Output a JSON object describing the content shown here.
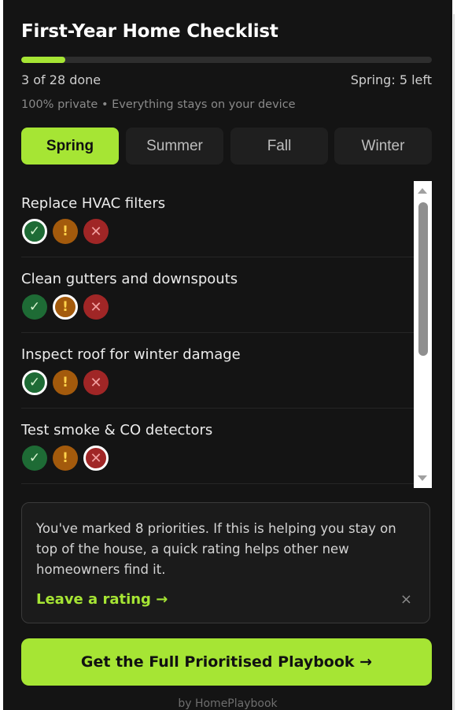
{
  "header": {
    "title": "First-Year Home Checklist",
    "progress_fraction": 0.107,
    "done_text": "3 of 28 done",
    "season_left_text": "Spring: 5 left",
    "privacy_note": "100% private • Everything stays on your device"
  },
  "tabs": [
    {
      "label": "Spring",
      "active": true
    },
    {
      "label": "Summer",
      "active": false
    },
    {
      "label": "Fall",
      "active": false
    },
    {
      "label": "Winter",
      "active": false
    }
  ],
  "status_glyphs": {
    "ok": "✓",
    "warn": "!",
    "no": "✕"
  },
  "tasks": [
    {
      "title": "Replace HVAC filters",
      "selected": "ok"
    },
    {
      "title": "Clean gutters and downspouts",
      "selected": "warn"
    },
    {
      "title": "Inspect roof for winter damage",
      "selected": "ok"
    },
    {
      "title": "Test smoke & CO detectors",
      "selected": "no"
    }
  ],
  "rating_card": {
    "message": "You've marked 8 priorities. If this is helping you stay on top of the house, a quick rating helps other new homeowners find it.",
    "link_label": "Leave a rating →",
    "close_glyph": "×"
  },
  "cta": {
    "label": "Get the Full Prioritised Playbook →"
  },
  "footer": {
    "text": "by HomePlaybook"
  },
  "colors": {
    "accent": "#a6e534",
    "background": "#141414",
    "ok": "#1e6b35",
    "warn": "#a35a0c",
    "no": "#a02626"
  }
}
